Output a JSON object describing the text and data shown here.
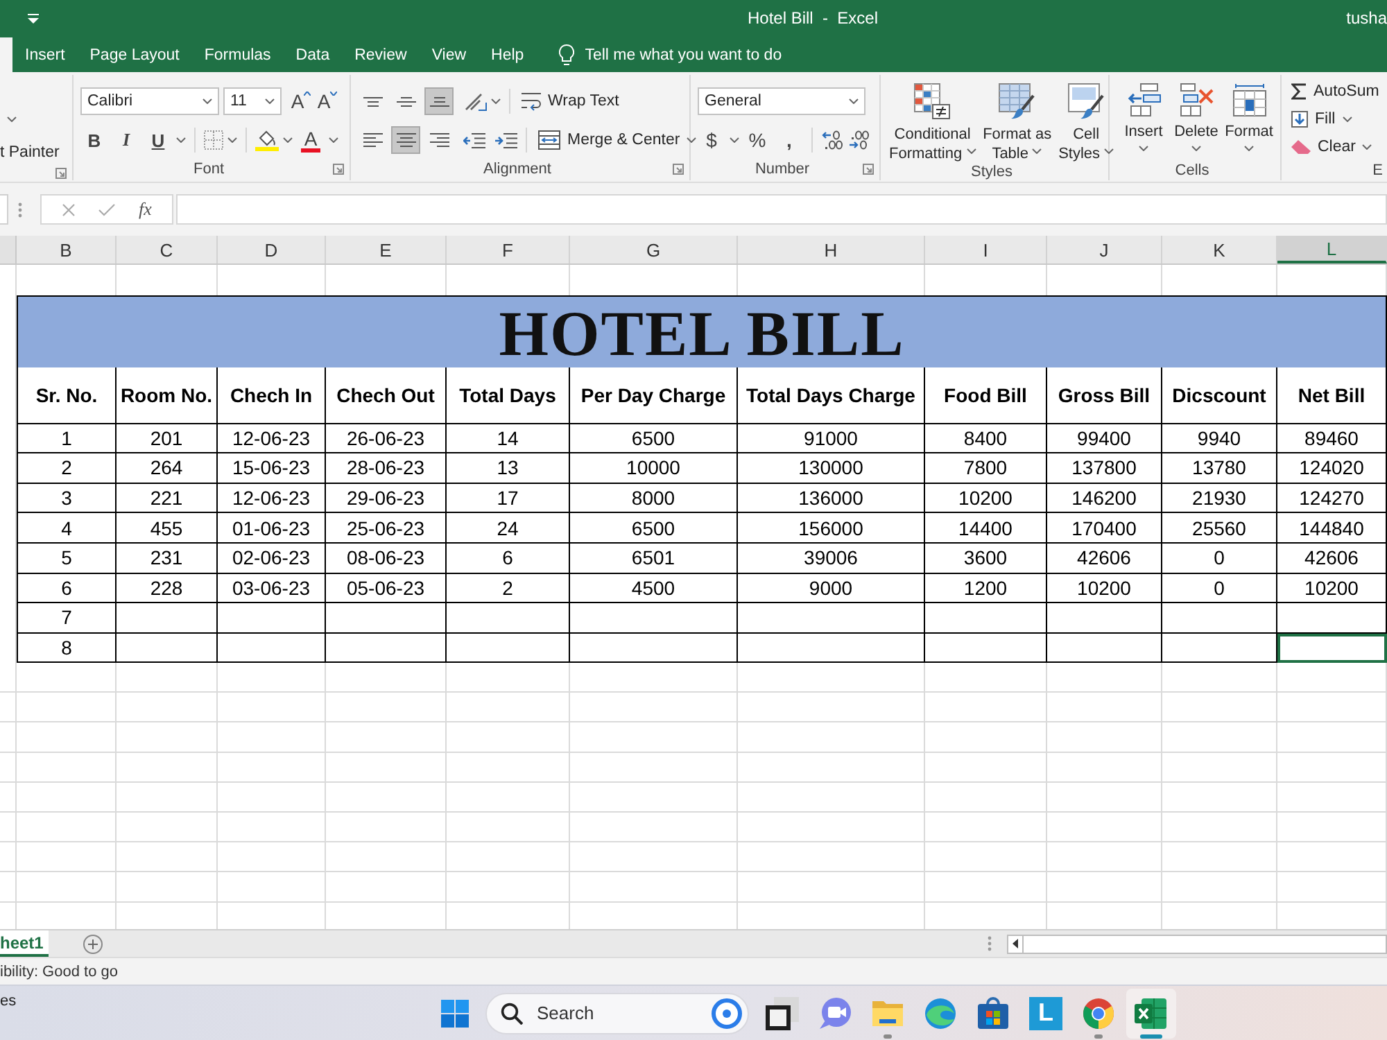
{
  "title_bar": {
    "title": "Hotel Bill  -  Excel",
    "user": "tusha"
  },
  "ribbon_tabs": [
    {
      "selected": true
    },
    {
      "label": "Insert",
      "selected": false
    },
    {
      "label": "Page Layout",
      "selected": false
    },
    {
      "label": "Formulas",
      "selected": false
    },
    {
      "label": "Data",
      "selected": false
    },
    {
      "label": "Review",
      "selected": false
    },
    {
      "label": "View",
      "selected": false
    },
    {
      "label": "Help",
      "selected": false
    }
  ],
  "tell_me": {
    "placeholder": "Tell me what you want to do"
  },
  "ribbon": {
    "clipboard": {
      "format_painter": "t Painter"
    },
    "font": {
      "label": "Font",
      "font_name": "Calibri",
      "font_size": "11",
      "grow": "A",
      "shrink": "A",
      "bold": "B",
      "italic": "I",
      "underline": "U",
      "font_color": "A"
    },
    "alignment": {
      "label": "Alignment",
      "vertical": [
        {
          "kind": "top",
          "selected": false
        },
        {
          "kind": "middle",
          "selected": false
        },
        {
          "kind": "bottom",
          "selected": true
        }
      ],
      "horizontal": [
        {
          "kind": "left",
          "selected": false
        },
        {
          "kind": "center",
          "selected": true
        },
        {
          "kind": "right",
          "selected": false
        }
      ],
      "wrap_text": "Wrap Text",
      "merge": "Merge & Center"
    },
    "number": {
      "label": "Number",
      "format": "General",
      "currency": "$",
      "percent": "%",
      "comma": ","
    },
    "styles": {
      "label": "Styles",
      "buttons": [
        {
          "kind": "conditional",
          "label": "Conditional Formatting"
        },
        {
          "kind": "table",
          "label": "Format as Table"
        },
        {
          "kind": "cell",
          "label": "Cell Styles"
        }
      ]
    },
    "cells": {
      "label": "Cells",
      "buttons": [
        {
          "kind": "insert",
          "label": "Insert"
        },
        {
          "kind": "delete",
          "label": "Delete"
        },
        {
          "kind": "format",
          "label": "Format"
        }
      ]
    },
    "editing": {
      "label": "E",
      "buttons": [
        {
          "kind": "autosum",
          "label": "AutoSum"
        },
        {
          "kind": "fill",
          "label": "Fill"
        },
        {
          "kind": "clear",
          "label": "Clear"
        }
      ]
    }
  },
  "formula_bar": {
    "insert_function": "fx"
  },
  "sheet": {
    "columns": [
      {
        "label": "B",
        "selected": false
      },
      {
        "label": "C",
        "selected": false
      },
      {
        "label": "D",
        "selected": false
      },
      {
        "label": "E",
        "selected": false
      },
      {
        "label": "F",
        "selected": false
      },
      {
        "label": "G",
        "selected": false
      },
      {
        "label": "H",
        "selected": false
      },
      {
        "label": "I",
        "selected": false
      },
      {
        "label": "J",
        "selected": false
      },
      {
        "label": "K",
        "selected": false
      },
      {
        "label": "L",
        "selected": true
      }
    ],
    "bill": {
      "title": "HOTEL BILL",
      "headers": [
        "Sr. No.",
        "Room No.",
        "Chech In",
        "Chech Out",
        "Total Days",
        "Per Day Charge",
        "Total Days Charge",
        "Food Bill",
        "Gross Bill",
        "Dicscount",
        "Net Bill"
      ],
      "rows": [
        {
          "cells": [
            "1",
            "201",
            "12-06-23",
            "26-06-23",
            "14",
            "6500",
            "91000",
            "8400",
            "99400",
            "9940",
            "89460"
          ],
          "active": false
        },
        {
          "cells": [
            "2",
            "264",
            "15-06-23",
            "28-06-23",
            "13",
            "10000",
            "130000",
            "7800",
            "137800",
            "13780",
            "124020"
          ],
          "active": false
        },
        {
          "cells": [
            "3",
            "221",
            "12-06-23",
            "29-06-23",
            "17",
            "8000",
            "136000",
            "10200",
            "146200",
            "21930",
            "124270"
          ],
          "active": false
        },
        {
          "cells": [
            "4",
            "455",
            "01-06-23",
            "25-06-23",
            "24",
            "6500",
            "156000",
            "14400",
            "170400",
            "25560",
            "144840"
          ],
          "active": false
        },
        {
          "cells": [
            "5",
            "231",
            "02-06-23",
            "08-06-23",
            "6",
            "6501",
            "39006",
            "3600",
            "42606",
            "0",
            "42606"
          ],
          "active": false
        },
        {
          "cells": [
            "6",
            "228",
            "03-06-23",
            "05-06-23",
            "2",
            "4500",
            "9000",
            "1200",
            "10200",
            "0",
            "10200"
          ],
          "active": false
        },
        {
          "cells": [
            "7"
          ],
          "active": false
        },
        {
          "cells": [
            "8"
          ],
          "active": true
        }
      ]
    }
  },
  "sheet_tabs": [
    {
      "label": "heet1",
      "selected": true
    }
  ],
  "status_bar": {
    "text": "ibility: Good to go"
  },
  "taskbar": {
    "widget": "es",
    "search": {
      "placeholder": "Search"
    },
    "apps": [
      {
        "kind": "stacked",
        "open": false,
        "active": false
      },
      {
        "kind": "chat",
        "open": false,
        "active": false
      },
      {
        "kind": "folder",
        "open": true,
        "active": false
      },
      {
        "kind": "swirl",
        "open": false,
        "active": false
      },
      {
        "kind": "store",
        "open": false,
        "active": false
      },
      {
        "kind": "letter",
        "label": "L",
        "open": false,
        "active": false
      },
      {
        "kind": "circle",
        "open": true,
        "active": false
      },
      {
        "kind": "sheet",
        "open": true,
        "active": true
      }
    ]
  }
}
